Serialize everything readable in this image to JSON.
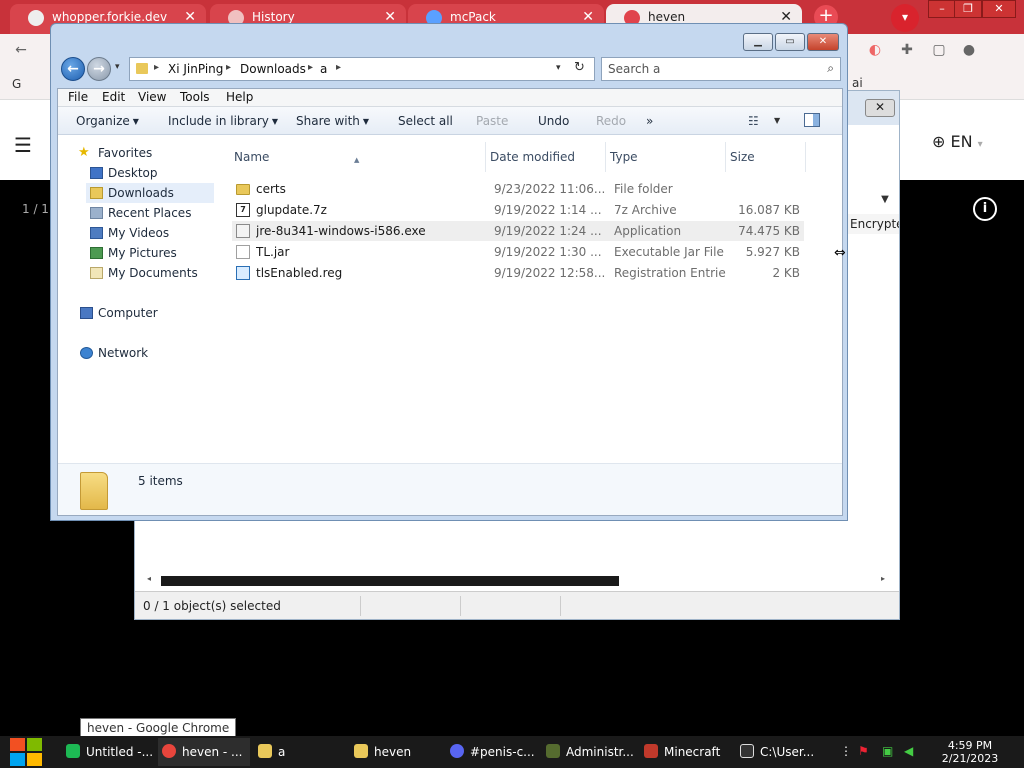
{
  "browser": {
    "tabs": [
      {
        "title": "whopper.forkie.dev",
        "active": false
      },
      {
        "title": "History",
        "active": false
      },
      {
        "title": "mcPack",
        "active": false
      },
      {
        "title": "heven",
        "active": true
      }
    ],
    "new_tab": "+",
    "bookmarks_label": "G",
    "bookmarks_right": "ai",
    "language": "EN",
    "page_counter": "1 / 1"
  },
  "back_window": {
    "column_label": "Encrypted",
    "status": {
      "selected": "0 / 1 object(s) selected"
    }
  },
  "explorer": {
    "breadcrumb": [
      "Xi JinPing",
      "Downloads",
      "a"
    ],
    "search_placeholder": "Search a",
    "menu": [
      "File",
      "Edit",
      "View",
      "Tools",
      "Help"
    ],
    "commands": {
      "organize": "Organize",
      "include": "Include in library",
      "share": "Share with",
      "select_all": "Select all",
      "paste": "Paste",
      "undo": "Undo",
      "redo": "Redo",
      "more": "»"
    },
    "nav": {
      "favorites": "Favorites",
      "desktop": "Desktop",
      "downloads": "Downloads",
      "recent": "Recent Places",
      "videos": "My Videos",
      "pictures": "My Pictures",
      "documents": "My Documents",
      "computer": "Computer",
      "network": "Network"
    },
    "columns": {
      "name": "Name",
      "date": "Date modified",
      "type": "Type",
      "size": "Size"
    },
    "files": [
      {
        "name": "certs",
        "date": "9/23/2022 11:06...",
        "type": "File folder",
        "size": "",
        "icon": "folder-icon"
      },
      {
        "name": "glupdate.7z",
        "date": "9/19/2022 1:14 ...",
        "type": "7z Archive",
        "size": "16.087 KB",
        "icon": "archive-icon"
      },
      {
        "name": "jre-8u341-windows-i586.exe",
        "date": "9/19/2022 1:24 ...",
        "type": "Application",
        "size": "74.475 KB",
        "icon": "exe-icon"
      },
      {
        "name": "TL.jar",
        "date": "9/19/2022 1:30 ...",
        "type": "Executable Jar File",
        "size": "5.927 KB",
        "icon": "jar-icon"
      },
      {
        "name": "tlsEnabled.reg",
        "date": "9/19/2022 12:58...",
        "type": "Registration Entries",
        "size": "2 KB",
        "icon": "registry-icon"
      }
    ],
    "details": {
      "count": "5 items"
    }
  },
  "tooltip": "heven - Google Chrome",
  "taskbar": {
    "items": [
      {
        "label": "Untitled -...",
        "color": "#1db954"
      },
      {
        "label": "heven - ...",
        "color": "#e8453c"
      },
      {
        "label": "a",
        "color": "#e9c85a"
      },
      {
        "label": "heven",
        "color": "#e9c85a"
      },
      {
        "label": "#penis-c...",
        "color": "#5865f2"
      },
      {
        "label": "Administr...",
        "color": "#556b2f"
      },
      {
        "label": "Minecraft",
        "color": "#c0392b"
      },
      {
        "label": "C:\\User...",
        "color": "#333333"
      }
    ],
    "time": "4:59 PM",
    "date": "2/21/2023"
  }
}
